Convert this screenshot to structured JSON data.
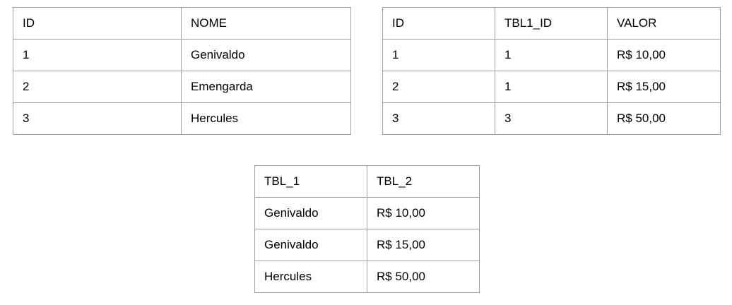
{
  "table_1": {
    "columns": [
      "ID",
      "NOME"
    ],
    "rows": [
      [
        "1",
        "Genivaldo"
      ],
      [
        "2",
        "Emengarda"
      ],
      [
        "3",
        "Hercules"
      ]
    ]
  },
  "table_2": {
    "columns": [
      "ID",
      "TBL1_ID",
      "VALOR"
    ],
    "rows": [
      [
        "1",
        "1",
        "R$ 10,00"
      ],
      [
        "2",
        "1",
        "R$ 15,00"
      ],
      [
        "3",
        "3",
        "R$ 50,00"
      ]
    ]
  },
  "table_3": {
    "columns": [
      "TBL_1",
      "TBL_2"
    ],
    "rows": [
      [
        "Genivaldo",
        "R$ 10,00"
      ],
      [
        "Genivaldo",
        "R$ 15,00"
      ],
      [
        "Hercules",
        "R$ 50,00"
      ]
    ]
  },
  "colors": {
    "border": "#a0a0a0",
    "text": "#000000",
    "background": "#ffffff"
  }
}
